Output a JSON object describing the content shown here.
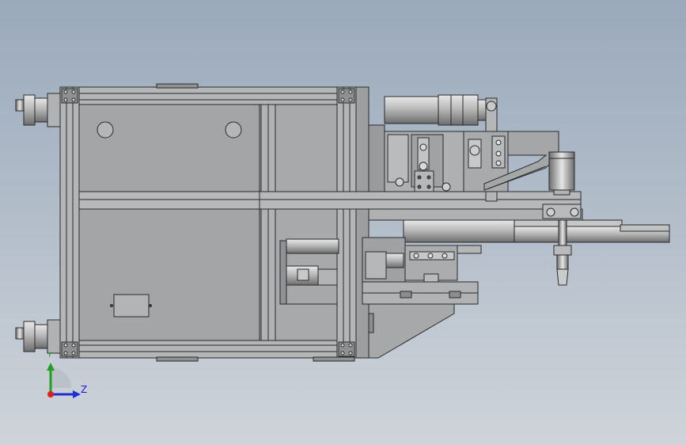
{
  "view": {
    "background_top": "#9aa9bb",
    "background_bottom": "#cfd4da",
    "part_fill": "#a4a6a8",
    "part_edge": "#2a2a2a"
  },
  "triad": {
    "y_label": "Y",
    "z_label": "Z",
    "x_axis_color": "#e02020",
    "y_axis_color": "#20a020",
    "z_axis_color": "#2030d0"
  }
}
